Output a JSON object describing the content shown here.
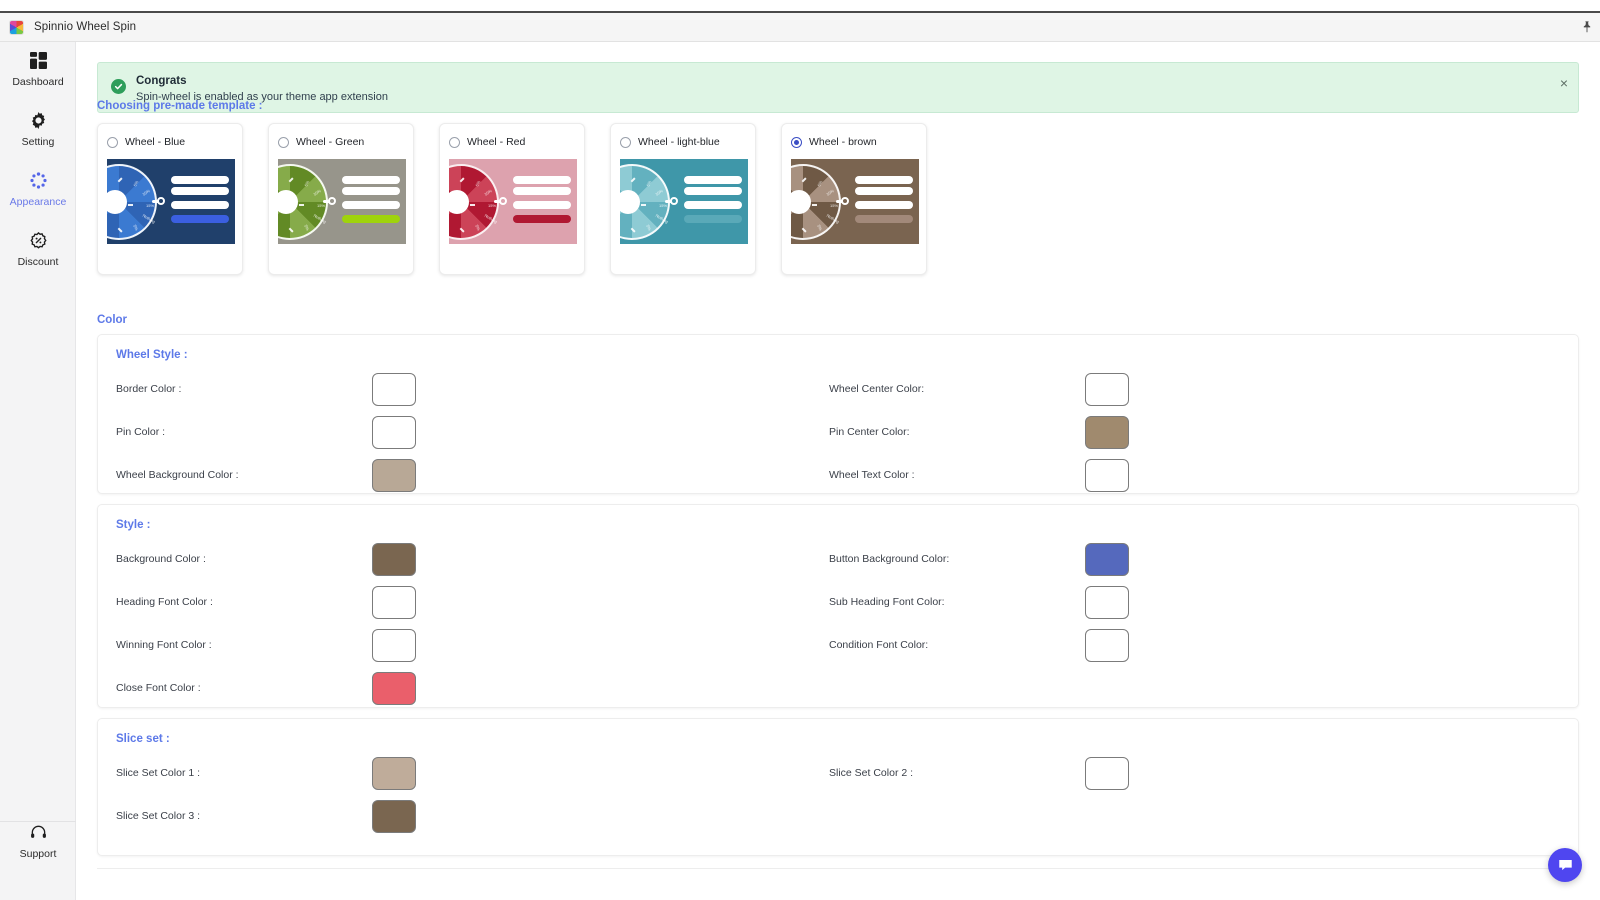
{
  "window": {
    "app_title": "Spinnio Wheel Spin",
    "app_icon": "rainbow-app-icon",
    "pin_icon": "pin-icon"
  },
  "sidebar": {
    "items": [
      {
        "label": "Dashboard",
        "icon": "dashboard-icon",
        "active": false
      },
      {
        "label": "Setting",
        "icon": "gear-icon",
        "active": false
      },
      {
        "label": "Appearance",
        "icon": "appearance-spinner-icon",
        "active": true
      },
      {
        "label": "Discount",
        "icon": "discount-badge-icon",
        "active": false
      }
    ],
    "support": {
      "label": "Support",
      "icon": "headset-icon"
    },
    "active_color": "#6b7ae8"
  },
  "banner": {
    "icon": "check-circle-icon",
    "title": "Congrats",
    "message": "Spin-wheel is enabled as your theme app extension",
    "close_label": "×",
    "background": "#dff5e5",
    "icon_color": "#2e9e5b"
  },
  "templates": {
    "heading": "Choosing pre-made template :",
    "items": [
      {
        "name": "Wheel - Blue",
        "selected": false,
        "preview_bg": "#20406b",
        "slice_a": "#2f64b5",
        "slice_b": "#3b7ad1",
        "accent_bar": "#3b5fe0"
      },
      {
        "name": "Wheel - Green",
        "selected": false,
        "preview_bg": "#97958b",
        "slice_a": "#628a25",
        "slice_b": "#86ab4a",
        "accent_bar": "#9fd30c"
      },
      {
        "name": "Wheel - Red",
        "selected": false,
        "preview_bg": "#dda2ae",
        "slice_a": "#b01832",
        "slice_b": "#cc4358",
        "accent_bar": "#b01832"
      },
      {
        "name": "Wheel - light-blue",
        "selected": false,
        "preview_bg": "#3f97a9",
        "slice_a": "#63b1bf",
        "slice_b": "#8ecbd4",
        "accent_bar": "#5aa9b8"
      },
      {
        "name": "Wheel - brown",
        "selected": true,
        "preview_bg": "#7a6450",
        "slice_a": "#6f5945",
        "slice_b": "#a89180",
        "accent_bar": "#a2897a"
      }
    ],
    "slice_labels": [
      "5%",
      "10%",
      "15%",
      "Nothing",
      "5%"
    ]
  },
  "color_section": {
    "heading": "Color",
    "wheel_style": {
      "title": "Wheel Style :",
      "fields": [
        {
          "label": "Border Color :",
          "value": "#ffffff",
          "column": "left"
        },
        {
          "label": "Wheel Center Color:",
          "value": "#ffffff",
          "column": "right"
        },
        {
          "label": "Pin Color :",
          "value": "#ffffff",
          "column": "left"
        },
        {
          "label": "Pin Center Color:",
          "value": "#a08a6e",
          "column": "right"
        },
        {
          "label": "Wheel Background Color :",
          "value": "#b8a896",
          "column": "left"
        },
        {
          "label": "Wheel Text Color :",
          "value": "#ffffff",
          "column": "right"
        }
      ]
    },
    "style": {
      "title": "Style :",
      "fields": [
        {
          "label": "Background Color :",
          "value": "#7a6650",
          "column": "left"
        },
        {
          "label": "Button Background Color:",
          "value": "#5569bd",
          "column": "right"
        },
        {
          "label": "Heading Font Color :",
          "value": "#ffffff",
          "column": "left"
        },
        {
          "label": "Sub Heading Font Color:",
          "value": "#ffffff",
          "column": "right"
        },
        {
          "label": "Winning Font Color :",
          "value": "#ffffff",
          "column": "left"
        },
        {
          "label": "Condition Font Color:",
          "value": "#ffffff",
          "column": "right"
        },
        {
          "label": "Close Font Color :",
          "value": "#ea5f6b",
          "column": "left"
        }
      ]
    },
    "slice_set": {
      "title": "Slice set :",
      "fields": [
        {
          "label": "Slice Set Color 1 :",
          "value": "#bfac9a",
          "column": "left"
        },
        {
          "label": "Slice Set Color 2 :",
          "value": "#9d8straight",
          "column": "right"
        },
        {
          "label": "Slice Set Color 3 :",
          "value": "#7a6650",
          "column": "left"
        }
      ]
    }
  },
  "chat": {
    "icon": "chat-bubble-icon",
    "color": "#4f46f0"
  }
}
